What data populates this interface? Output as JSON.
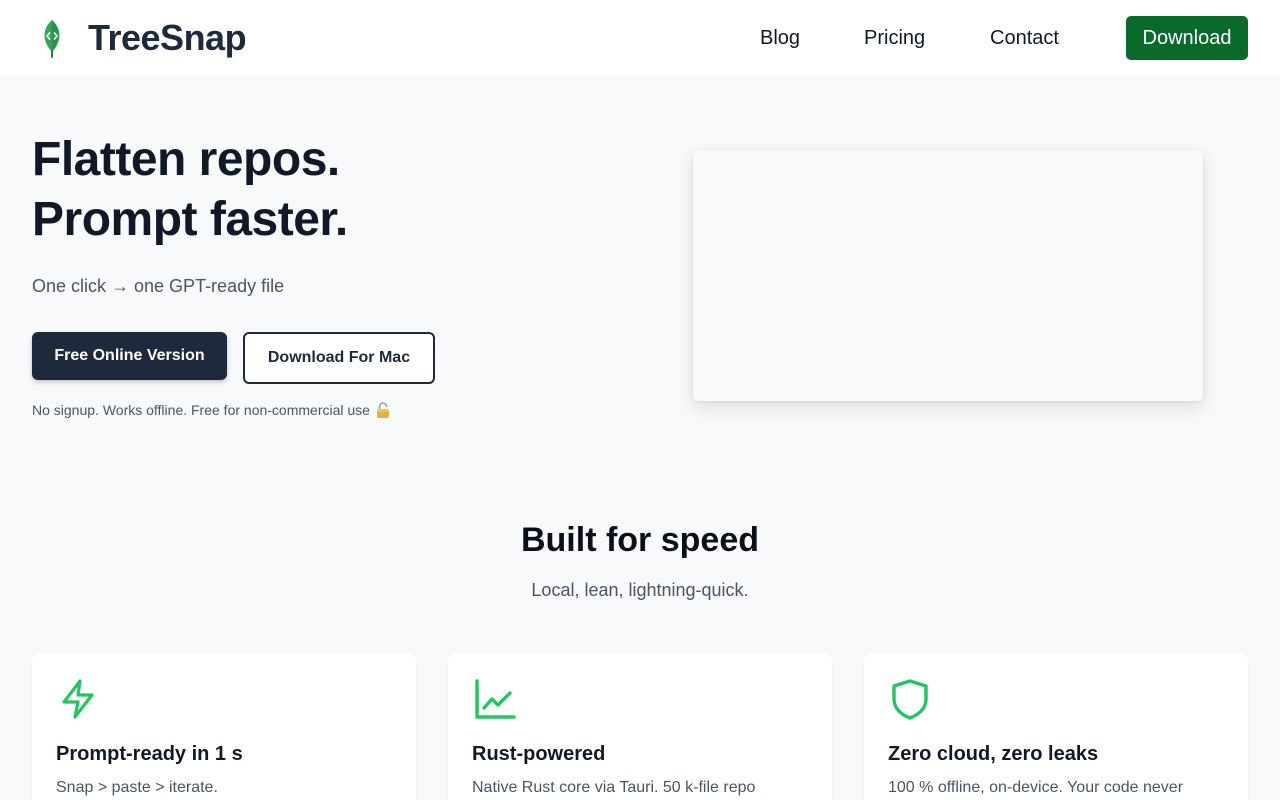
{
  "header": {
    "brand": "TreeSnap",
    "nav": {
      "blog": "Blog",
      "pricing": "Pricing",
      "contact": "Contact",
      "download": "Download"
    }
  },
  "hero": {
    "title_line1": "Flatten repos.",
    "title_line2": "Prompt faster.",
    "subtitle": "One click → one GPT-ready file",
    "primary_button": "Free Online Version",
    "secondary_button": "Download For Mac",
    "note": "No signup. Works offline. Free for non-commercial use"
  },
  "features": {
    "title": "Built for speed",
    "subtitle": "Local, lean, lightning-quick.",
    "cards": [
      {
        "icon": "lightning-icon",
        "title": "Prompt-ready in 1 s",
        "description": "Snap > paste > iterate."
      },
      {
        "icon": "chart-icon",
        "title": "Rust-powered",
        "description": "Native Rust core via Tauri. 50 k-file repo"
      },
      {
        "icon": "shield-icon",
        "title": "Zero cloud, zero leaks",
        "description": "100 % offline, on-device. Your code never"
      }
    ]
  },
  "colors": {
    "brand_green": "#0a6a2c",
    "icon_green": "#22c55e",
    "dark": "#1e293b"
  }
}
